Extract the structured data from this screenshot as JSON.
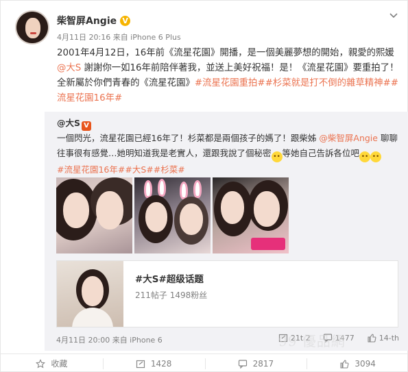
{
  "post": {
    "author": "柴智屏Angie",
    "verified_badge": "V",
    "meta": "4月11日 20:16 来自 iPhone 6 Plus",
    "text": {
      "part1": "2001年4月12日，16年前《流星花園》開播，是一個美麗夢想的開始，親愛的熙媛",
      "mention": "@大S",
      "part2": " 謝謝你一如16年前陪伴著我，並送上美好祝福！是！《流星花園》要重拍了！全新屬於你們青春的《流星花園》",
      "tags": "#流星花園重拍##杉菜就是打不倒的雜草精神##流星花園16年#"
    }
  },
  "retweet": {
    "author": "@大S",
    "author_badge": "V",
    "text_part1": "一個閃光，流星花園已經16年了！杉菜都是兩個孩子的媽了！跟柴姊 ",
    "mention": "@柴智屏Angie",
    "text_part2": " 聊聊往事很有感覺…她明知道我是老實人，還跟我說了個秘密",
    "text_part3": "等她自己告訴各位吧",
    "tags": "#流星花園16年##大S##杉菜#",
    "topic_card": {
      "title": "#大S#超级话题",
      "stats": "211帖子 1498粉丝"
    },
    "meta": "4月11日 20:00 来自 iPhone 6",
    "actions": {
      "forward": "21t 2",
      "comment": "1477",
      "like": "14-th"
    }
  },
  "watermark": "99 優品網",
  "bottom_bar": {
    "favorite": "收藏",
    "forward": "1428",
    "comment": "2817",
    "like": "3094"
  },
  "colors": {
    "link": "#eb7350",
    "muted": "#808080",
    "retweet_bg": "#f2f2f5",
    "verified": "#f6b400"
  },
  "icons": [
    "chevron-down-icon",
    "share-icon",
    "comment-icon",
    "like-icon",
    "favorite-icon",
    "cry-emoji-icon",
    "tongue-emoji-icon"
  ]
}
